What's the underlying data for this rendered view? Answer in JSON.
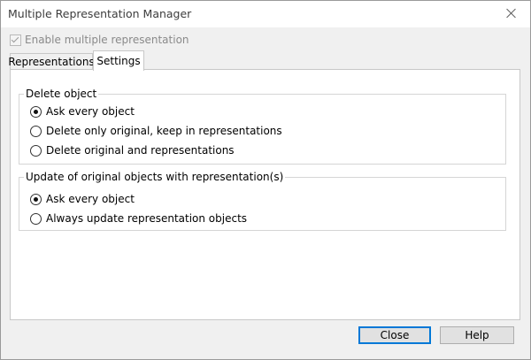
{
  "window": {
    "title": "Multiple Representation Manager"
  },
  "enable_checkbox": {
    "label": "Enable multiple representation",
    "checked": true,
    "enabled": false
  },
  "tabs": [
    {
      "label": "Representations",
      "active": false
    },
    {
      "label": "Settings",
      "active": true
    }
  ],
  "delete_group": {
    "legend": "Delete object",
    "options": [
      {
        "label": "Ask every object",
        "selected": true
      },
      {
        "label": "Delete only original, keep in representations",
        "selected": false
      },
      {
        "label": "Delete original and representations",
        "selected": false
      }
    ]
  },
  "update_group": {
    "legend": "Update of original objects with representation(s)",
    "options": [
      {
        "label": "Ask every object",
        "selected": true
      },
      {
        "label": "Always update representation objects",
        "selected": false
      }
    ]
  },
  "buttons": {
    "close": "Close",
    "help": "Help"
  }
}
